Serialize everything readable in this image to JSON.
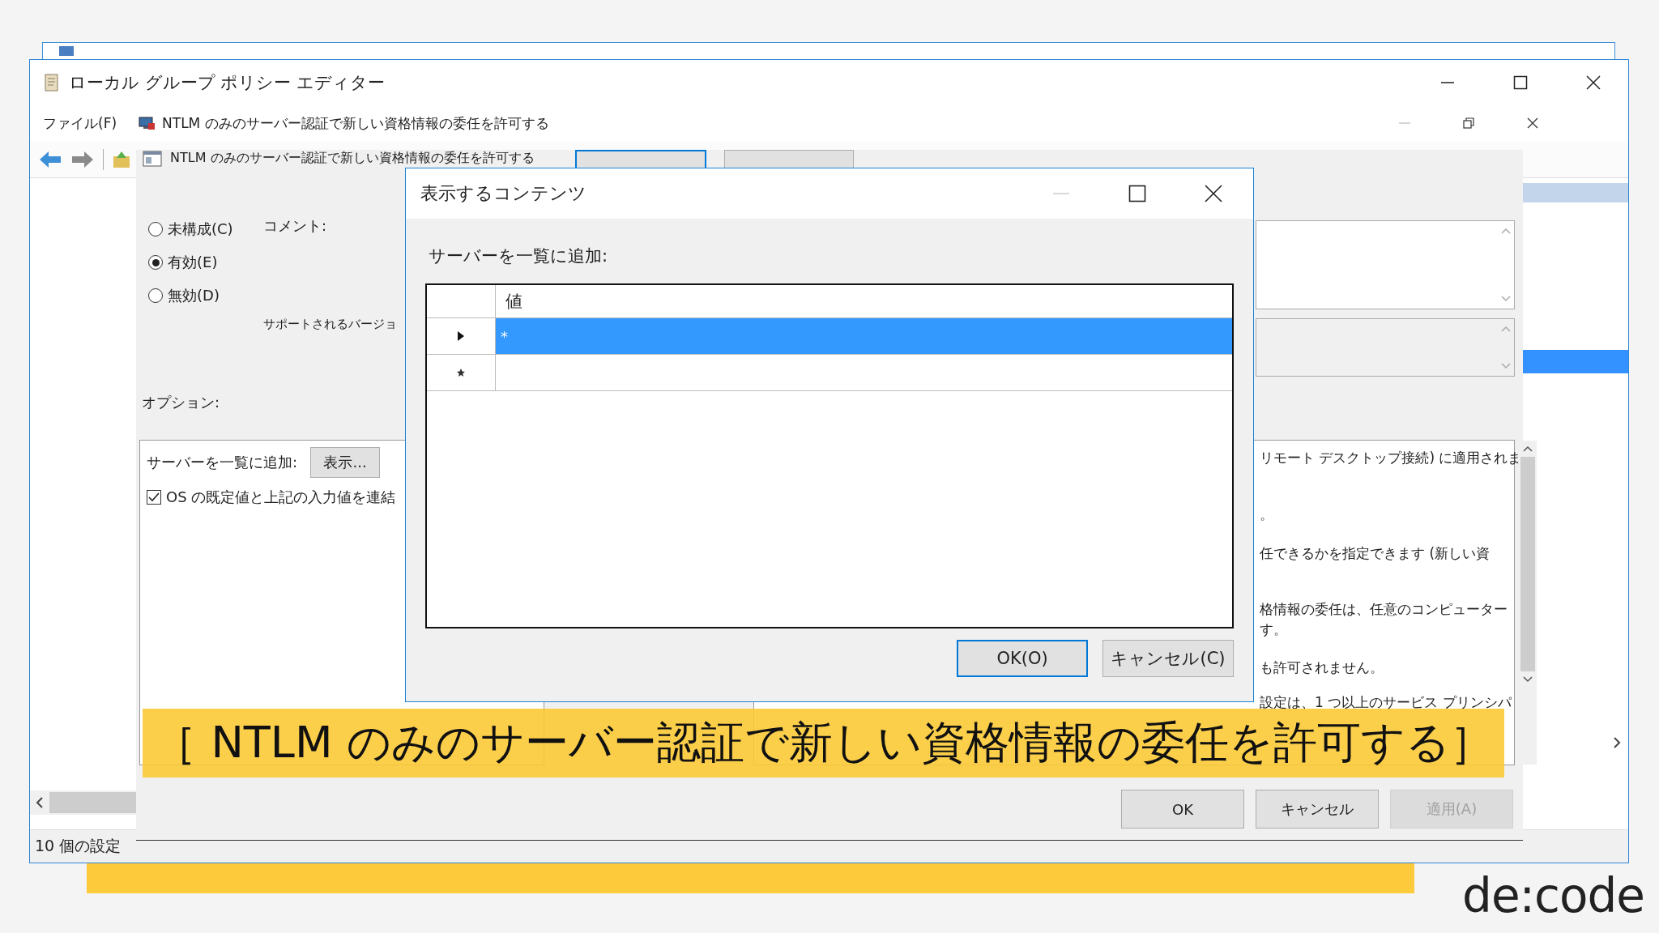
{
  "main_window": {
    "title": "ローカル グループ ポリシー エディター",
    "menu": [
      "ファイル(F)"
    ],
    "child_title": "NTLM のみのサーバー認証で新しい資格情報の委任を許可する",
    "settings_list": {
      "rows": [
        {
          "selected": false
        },
        {
          "selected": false
        },
        {
          "selected": false
        },
        {
          "selected": false
        },
        {
          "selected": false
        },
        {
          "selected": false
        },
        {
          "selected": true
        }
      ]
    },
    "status_bar": "10 個の設定"
  },
  "policy_dialog": {
    "title": "NTLM のみのサーバー認証で新しい資格情報の委任を許可する",
    "state_options": [
      {
        "label": "未構成(C)",
        "selected": false
      },
      {
        "label": "有効(E)",
        "selected": true
      },
      {
        "label": "無効(D)",
        "selected": false
      }
    ],
    "comment_label": "コメント:",
    "supported_label": "サポートされるバージョ",
    "options_label": "オプション:",
    "options": {
      "server_list_label": "サーバーを一覧に追加:",
      "show_button": "表示...",
      "concat_checkbox": {
        "label": "OS の既定値と上記の入力値を連結",
        "checked": true
      }
    },
    "help_lines": [
      "リモート デスクトップ接続) に適用されま",
      "。",
      "任できるかを指定できます (新しい資",
      "格情報の委任は、任意のコンピューター",
      "す。",
      "も許可されません。",
      "設定は、1 つ以上のサービス プリンシパ"
    ],
    "buttons": [
      {
        "label": "OK",
        "disabled": false
      },
      {
        "label": "キャンセル",
        "disabled": false
      },
      {
        "label": "適用(A)",
        "disabled": true
      }
    ]
  },
  "content_dialog": {
    "title": "表示するコンテンツ",
    "title_buttons": [
      {
        "kind": "minimize",
        "disabled": true
      },
      {
        "kind": "maximize",
        "disabled": false
      },
      {
        "kind": "close",
        "disabled": false
      }
    ],
    "label": "サーバーを一覧に追加:",
    "grid": {
      "columns": [
        "値"
      ],
      "rows": [
        {
          "kind": "current",
          "value": "*",
          "selected": true
        },
        {
          "kind": "new",
          "selected": false
        }
      ]
    },
    "buttons": [
      {
        "label": "OK(O)",
        "default": true
      },
      {
        "label": "キャンセル(C)",
        "default": false
      }
    ]
  },
  "caption": "［ NTLM のみのサーバー認証で新しい資格情報の委任を許可する］",
  "logo": "de:code"
}
